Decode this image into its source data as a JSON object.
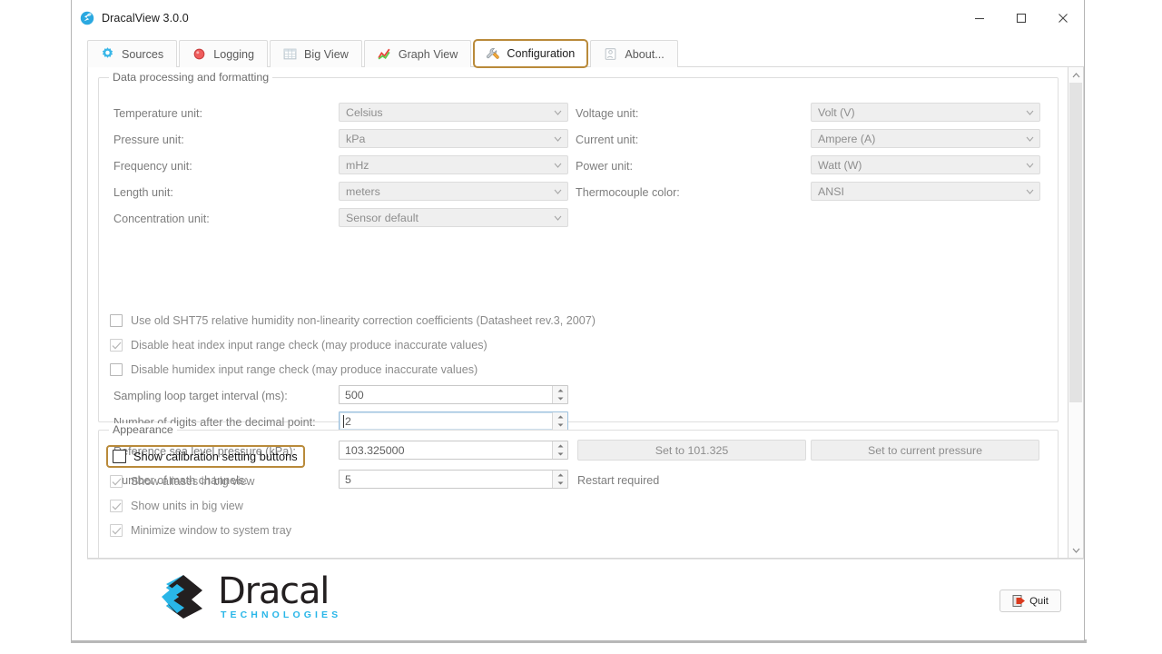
{
  "window": {
    "title": "DracalView 3.0.0",
    "icon": "dracal-app-icon",
    "controls": {
      "minimize": "minimize-icon",
      "maximize": "maximize-icon",
      "close": "close-icon"
    }
  },
  "tabs": [
    {
      "label": "Sources",
      "icon": "gear-icon",
      "active": false
    },
    {
      "label": "Logging",
      "icon": "record-dot-icon",
      "active": false
    },
    {
      "label": "Big View",
      "icon": "grid-table-icon",
      "active": false
    },
    {
      "label": "Graph View",
      "icon": "line-chart-icon",
      "active": false
    },
    {
      "label": "Configuration",
      "icon": "wrench-icon",
      "active": true
    },
    {
      "label": "About...",
      "icon": "info-card-icon",
      "active": false
    }
  ],
  "groups": {
    "data_processing": {
      "title": "Data processing and formatting",
      "combos_left": [
        {
          "label": "Temperature unit:",
          "value": "Celsius",
          "disabled": true
        },
        {
          "label": "Pressure unit:",
          "value": "kPa",
          "disabled": true
        },
        {
          "label": "Frequency unit:",
          "value": "mHz",
          "disabled": true
        },
        {
          "label": "Length unit:",
          "value": "meters",
          "disabled": true
        },
        {
          "label": "Concentration unit:",
          "value": "Sensor default",
          "disabled": true
        }
      ],
      "combos_right": [
        {
          "label": "Voltage unit:",
          "value": "Volt (V)",
          "disabled": true
        },
        {
          "label": "Current unit:",
          "value": "Ampere (A)",
          "disabled": true
        },
        {
          "label": "Power unit:",
          "value": "Watt (W)",
          "disabled": true
        },
        {
          "label": "Thermocouple color:",
          "value": "ANSI",
          "disabled": true
        }
      ],
      "checkboxes": [
        {
          "label": "Use old SHT75 relative humidity non-linearity correction coefficients (Datasheet rev.3, 2007)",
          "checked": false
        },
        {
          "label": "Disable heat index input range check (may produce inaccurate values)",
          "checked": true
        },
        {
          "label": "Disable humidex input range check (may produce inaccurate values)",
          "checked": false
        }
      ],
      "spinners": [
        {
          "label": "Sampling loop target interval (ms):",
          "value": "500",
          "focused": false
        },
        {
          "label": "Number of digits after the decimal point:",
          "value": "2",
          "focused": true
        },
        {
          "label": "Reference sea level pressure (kPa):",
          "value": "103.325000",
          "focused": false
        },
        {
          "label": "Number of math channels:",
          "value": "5",
          "focused": false
        }
      ],
      "buttons": [
        {
          "label": "Set to 101.325"
        },
        {
          "label": "Set to current pressure"
        }
      ],
      "restart_note": "Restart required"
    },
    "appearance": {
      "title": "Appearance",
      "checkboxes": [
        {
          "label": "Show calibration setting buttons",
          "checked": false,
          "highlighted": true
        },
        {
          "label": "Show aliases in big view",
          "checked": true,
          "highlighted": false
        },
        {
          "label": "Show units in big view",
          "checked": true,
          "highlighted": false
        },
        {
          "label": "Minimize window to system tray",
          "checked": true,
          "highlighted": false
        }
      ]
    }
  },
  "footer": {
    "brand_name": "Dracal",
    "brand_sub": "TECHNOLOGIES",
    "quit_label": "Quit",
    "quit_icon": "exit-door-icon"
  },
  "scrollbar": {
    "up_icon": "chevron-up-icon",
    "down_icon": "chevron-down-icon"
  },
  "colors": {
    "accent_highlight": "#b98a3a",
    "brand_cyan": "#29b6e8",
    "brand_dark": "#231f20",
    "focus_blue": "#9cc0dd"
  }
}
